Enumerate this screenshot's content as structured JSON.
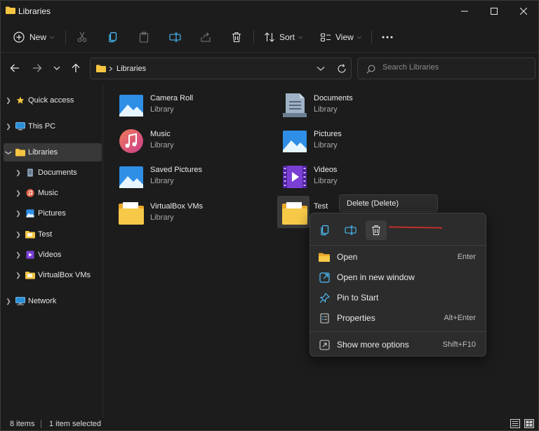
{
  "window": {
    "title": "Libraries"
  },
  "toolbar": {
    "new_label": "New",
    "sort_label": "Sort",
    "view_label": "View"
  },
  "address": {
    "path": "Libraries"
  },
  "search": {
    "placeholder": "Search Libraries"
  },
  "sidebar": {
    "items": [
      {
        "label": "Quick access",
        "icon": "star-icon"
      },
      {
        "label": "This PC",
        "icon": "pc-icon"
      },
      {
        "label": "Libraries",
        "icon": "folder-icon",
        "selected": true
      },
      {
        "label": "Documents",
        "icon": "documents-icon"
      },
      {
        "label": "Music",
        "icon": "music-icon"
      },
      {
        "label": "Pictures",
        "icon": "pictures-icon"
      },
      {
        "label": "Test",
        "icon": "folder-icon"
      },
      {
        "label": "Videos",
        "icon": "videos-icon"
      },
      {
        "label": "VirtualBox VMs",
        "icon": "folder-icon"
      },
      {
        "label": "Network",
        "icon": "network-icon"
      }
    ]
  },
  "libraries": [
    {
      "name": "Camera Roll",
      "type": "Library"
    },
    {
      "name": "Documents",
      "type": "Library"
    },
    {
      "name": "Music",
      "type": "Library"
    },
    {
      "name": "Pictures",
      "type": "Library"
    },
    {
      "name": "Saved Pictures",
      "type": "Library"
    },
    {
      "name": "Videos",
      "type": "Library"
    },
    {
      "name": "VirtualBox VMs",
      "type": "Library"
    },
    {
      "name": "Test",
      "type": ""
    }
  ],
  "tooltip": {
    "text": "Delete (Delete)"
  },
  "context_menu": {
    "items": [
      {
        "label": "Open",
        "shortcut": "Enter"
      },
      {
        "label": "Open in new window",
        "shortcut": ""
      },
      {
        "label": "Pin to Start",
        "shortcut": ""
      },
      {
        "label": "Properties",
        "shortcut": "Alt+Enter"
      },
      {
        "label": "Show more options",
        "shortcut": "Shift+F10"
      }
    ]
  },
  "status": {
    "count": "8 items",
    "selection": "1 item selected"
  },
  "colors": {
    "accent": "#4cc2ff",
    "folder": "#f5c542",
    "annotation": "#c0302c"
  }
}
